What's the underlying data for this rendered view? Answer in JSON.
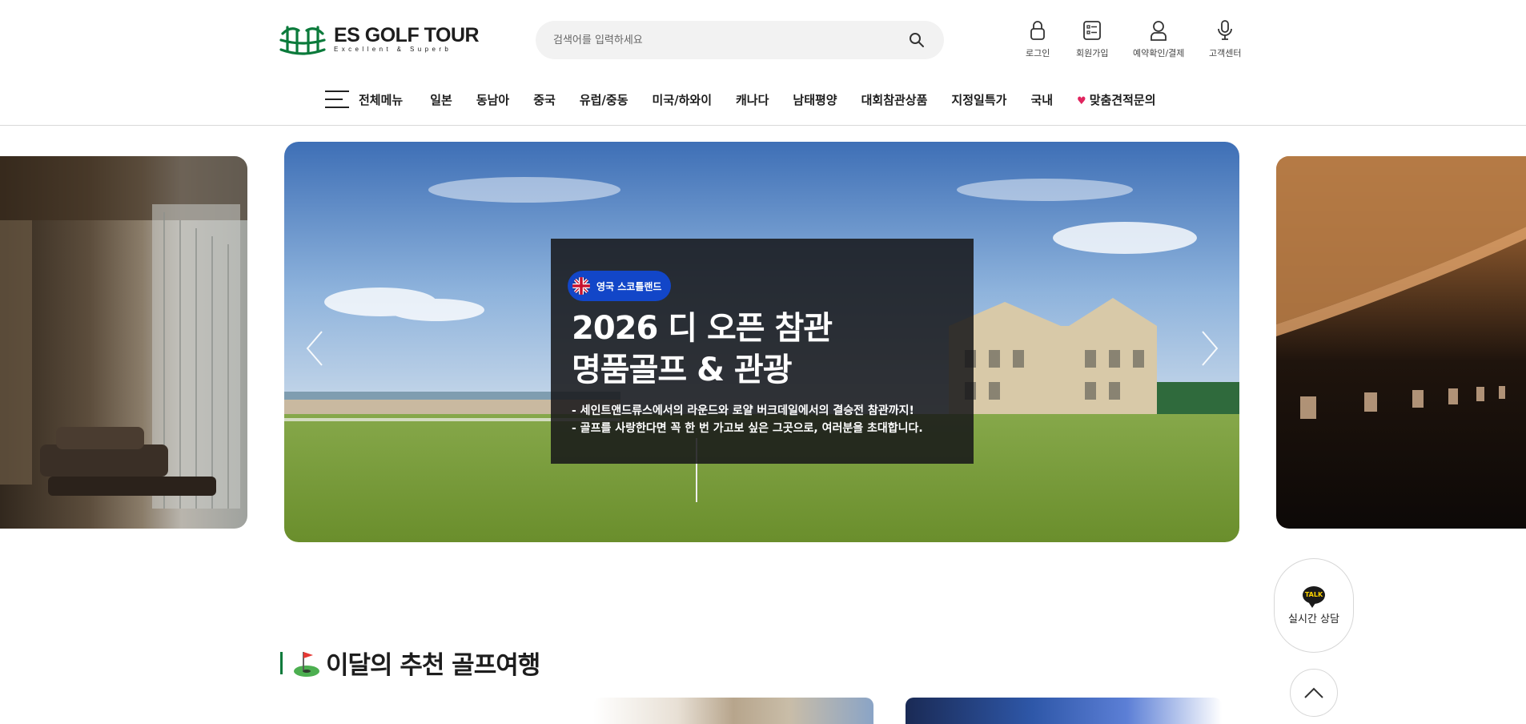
{
  "brand": {
    "title": "ES GOLF TOUR",
    "tagline": "Excellent & Superb",
    "colors": {
      "green": "#0b7a3b"
    }
  },
  "search": {
    "placeholder": "검색어를 입력하세요",
    "icon": "search-icon"
  },
  "utility": [
    {
      "label": "로그인",
      "icon": "lock-icon"
    },
    {
      "label": "회원가입",
      "icon": "form-icon"
    },
    {
      "label": "예약확인/결제",
      "icon": "user-icon"
    },
    {
      "label": "고객센터",
      "icon": "microphone-icon"
    }
  ],
  "nav": {
    "all_menu": "전체메뉴",
    "items": [
      "일본",
      "동남아",
      "중국",
      "유럽/중동",
      "미국/하와이",
      "캐나다",
      "남태평양",
      "대회참관상품",
      "지정일특가",
      "국내",
      "맞춤견적문의"
    ]
  },
  "slide": {
    "badge": "영국 스코틀랜드",
    "title_line1": "2026 디 오픈 참관",
    "title_line2": "명품골프 & 관광",
    "desc_line1": "- 세인트앤드류스에서의 라운드와 로얄 버크데일에서의 결승전 참관까지!",
    "desc_line2": "- 골프를 사랑한다면 꼭 한 번 가고보 싶은 그곳으로, 여러분을 초대합니다."
  },
  "floating": {
    "talk_badge": "TALK",
    "talk_label": "실시간 상담"
  },
  "section": {
    "title": "이달의 추천 골프여행"
  }
}
